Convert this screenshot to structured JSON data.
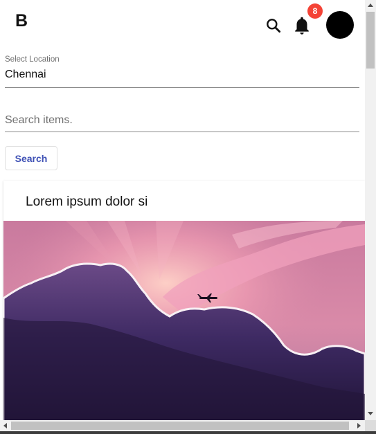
{
  "header": {
    "logo_text": "B",
    "notification_count": "8",
    "badge_color": "#f44336"
  },
  "location": {
    "label": "Select Location",
    "value": "Chennai"
  },
  "search": {
    "placeholder": "Search items.",
    "value": "",
    "button_label": "Search",
    "button_color": "#3f51b5"
  },
  "card": {
    "title": "Lorem ipsum dolor si",
    "image_description_icon": "sunset-clouds-airplane-image"
  },
  "icons": {
    "search": "search-icon",
    "bell": "bell-icon",
    "avatar": "avatar"
  }
}
